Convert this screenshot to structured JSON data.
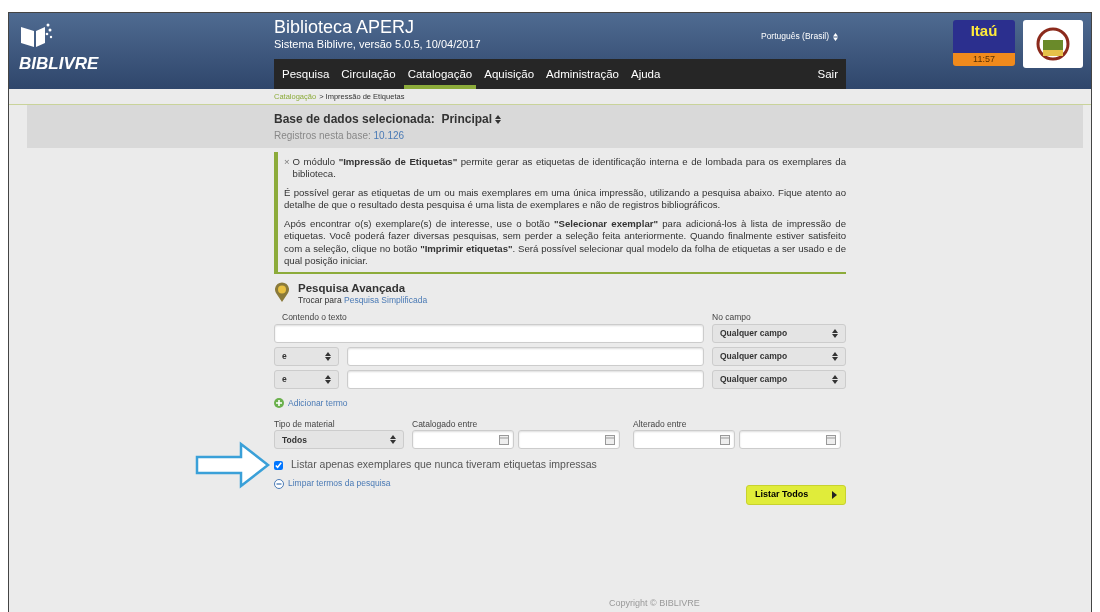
{
  "header": {
    "logo_text": "BIBLIVRE",
    "title": "Biblioteca APERJ",
    "subtitle": "Sistema Biblivre, versão 5.0.5, 10/04/2017",
    "language": "Português (Brasil)",
    "bank": {
      "name": "Itaú",
      "time": "11:57"
    }
  },
  "menu": [
    {
      "label": "Pesquisa",
      "selected": false
    },
    {
      "label": "Circulação",
      "selected": false
    },
    {
      "label": "Catalogação",
      "selected": true
    },
    {
      "label": "Aquisição",
      "selected": false
    },
    {
      "label": "Administração",
      "selected": false
    },
    {
      "label": "Ajuda",
      "selected": false
    }
  ],
  "logout": "Sair",
  "breadcrumb": {
    "link": "Catalogação",
    "current": "> Impressão de Etiquetas"
  },
  "database": {
    "label": "Base de dados selecionada:",
    "value": "Principal",
    "count_label": "Registros nesta base:",
    "count": "10.126"
  },
  "info": {
    "close": "×",
    "paragraphs": [
      "O módulo **\"Impressão de Etiquetas\"** permite gerar as etiquetas de identificação interna e de lombada para os exemplares da biblioteca.",
      "É possível gerar as etiquetas de um ou mais exemplares em uma única impressão, utilizando a pesquisa abaixo. Fique atento ao detalhe de que o resultado desta pesquisa é uma lista de exemplares e não de registros bibliográficos.",
      "Após encontrar o(s) exemplare(s) de interesse, use o botão **\"Selecionar exemplar\"** para adicioná-los à lista de impressão de etiquetas. Você poderá fazer diversas pesquisas, sem perder a seleção feita anteriormente. Quando finalmente estiver satisfeito com a seleção, clique no botão **\"Imprimir etiquetas\"**. Será possível selecionar qual modelo da folha de etiquetas a ser usado e de qual posição iniciar."
    ]
  },
  "search": {
    "title": "Pesquisa Avançada",
    "switch_text": "Trocar para",
    "switch_link": "Pesquisa Simplificada",
    "text_label": "Contendo o texto",
    "field_label": "No campo",
    "terms": [
      {
        "field": "Qualquer campo"
      },
      {
        "operator": "e",
        "field": "Qualquer campo"
      },
      {
        "operator": "e",
        "field": "Qualquer campo"
      }
    ],
    "add_term": "Adicionar termo",
    "material_label": "Tipo de material",
    "material": "Todos",
    "cataloged_label": "Catalogado entre",
    "altered_label": "Alterado entre",
    "only_unprinted": {
      "label": "Listar apenas exemplares que nunca tiveram etiquetas impressas",
      "checked": true
    },
    "clear": "Limpar termos da pesquisa",
    "list_all": "Listar Todos"
  },
  "footer": "Copyright © BIBLIVRE"
}
